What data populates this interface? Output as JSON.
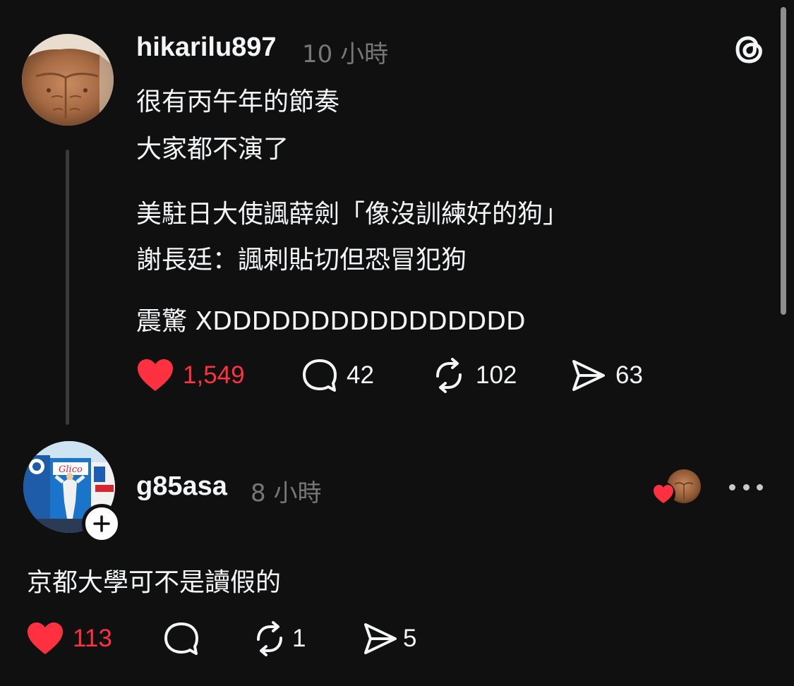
{
  "post": {
    "username": "hikarilu897",
    "time": "10 小時",
    "lines": [
      "很有丙午年的節奏",
      "大家都不演了",
      "美駐日大使諷薛劍「像沒訓練好的狗」",
      "謝長廷：諷刺貼切但恐冒犯狗",
      "震驚 XDDDDDDDDDDDDDDDD"
    ],
    "likes": "1,549",
    "comments": "42",
    "reposts": "102",
    "shares": "63",
    "liked": true
  },
  "reply": {
    "username": "g85asa",
    "time": "8 小時",
    "text": "京都大學可不是讀假的",
    "likes": "113",
    "reposts": "1",
    "shares": "5",
    "liked": true
  },
  "colors": {
    "background": "#101010",
    "like_red": "#ff3040",
    "text": "#f3f5f7",
    "muted": "#777777"
  },
  "icons": {
    "like": "heart-icon",
    "comment": "comment-bubble-icon",
    "repost": "repost-icon",
    "share": "share-send-icon",
    "app": "threads-logo-icon",
    "more": "more-options-icon",
    "follow": "plus-icon"
  }
}
